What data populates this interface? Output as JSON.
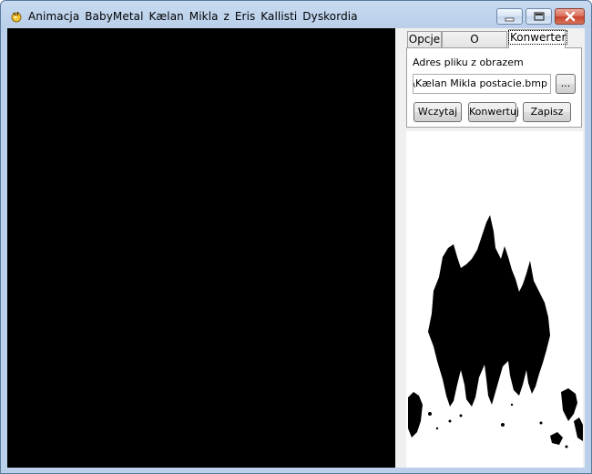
{
  "window": {
    "title": "Animacja  BabyMetal  Kælan Mikla  z  Eris  Kallisti  Dyskordia"
  },
  "tabs": [
    {
      "label": "Opcje",
      "active": false
    },
    {
      "label": "O programie",
      "active": false
    },
    {
      "label": "Konwerter",
      "active": true
    }
  ],
  "converter": {
    "file_label": "Adres pliku z obrazem",
    "file_path": "alog\\Kælan Mikla postacie.bmp",
    "browse_label": "...",
    "load_label": "Wczytaj",
    "convert_label": "Konwertuj",
    "save_label": "Zapisz"
  },
  "colors": {
    "canvas": "#000000",
    "titlebar": "#bad0ea",
    "close_button": "#c7432c"
  }
}
